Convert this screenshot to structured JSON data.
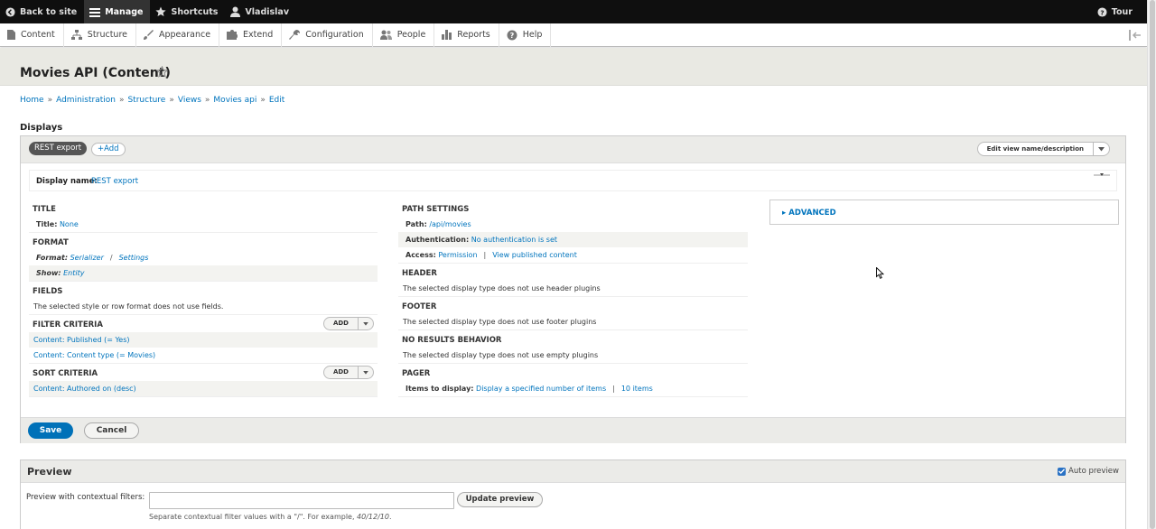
{
  "toolbar": {
    "back": "Back to site",
    "manage": "Manage",
    "shortcuts": "Shortcuts",
    "user": "Vladislav",
    "tour": "Tour"
  },
  "tray": [
    {
      "label": "Content",
      "icon": "file-icon"
    },
    {
      "label": "Structure",
      "icon": "structure-icon"
    },
    {
      "label": "Appearance",
      "icon": "brush-icon"
    },
    {
      "label": "Extend",
      "icon": "puzzle-icon"
    },
    {
      "label": "Configuration",
      "icon": "wrench-icon"
    },
    {
      "label": "People",
      "icon": "people-icon"
    },
    {
      "label": "Reports",
      "icon": "bar-chart-icon"
    },
    {
      "label": "Help",
      "icon": "help-icon"
    }
  ],
  "page": {
    "title": "Movies API (Content)"
  },
  "breadcrumb": [
    "Home",
    "Administration",
    "Structure",
    "Views",
    "Movies api",
    "Edit"
  ],
  "breadcrumb_sep": "»",
  "displays": {
    "heading": "Displays",
    "active_tab": "REST export",
    "add_tab": "+Add",
    "edit_name": "Edit view name/description"
  },
  "display_name": {
    "label": "Display name:",
    "value": "REST export"
  },
  "col1": {
    "title": {
      "heading": "TITLE",
      "label": "Title:",
      "value": "None"
    },
    "format": {
      "heading": "FORMAT",
      "format_label": "Format:",
      "format_value": "Serializer",
      "format_sep": "/",
      "settings": "Settings",
      "show_label": "Show:",
      "show_value": "Entity"
    },
    "fields": {
      "heading": "FIELDS",
      "text": "The selected style or row format does not use fields."
    },
    "filter": {
      "heading": "FILTER CRITERIA",
      "add": "Add",
      "items": [
        "Content: Published (= Yes)",
        "Content: Content type (= Movies)"
      ]
    },
    "sort": {
      "heading": "SORT CRITERIA",
      "add": "Add",
      "items": [
        "Content: Authored on (desc)"
      ]
    }
  },
  "col2": {
    "path": {
      "heading": "PATH SETTINGS",
      "path_label": "Path:",
      "path_value": "/api/movies",
      "auth_label": "Authentication:",
      "auth_value": "No authentication is set",
      "access_label": "Access:",
      "access_value": "Permission",
      "access_sep": "|",
      "access_extra": "View published content"
    },
    "header": {
      "heading": "HEADER",
      "text": "The selected display type does not use header plugins"
    },
    "footer": {
      "heading": "FOOTER",
      "text": "The selected display type does not use footer plugins"
    },
    "noresults": {
      "heading": "NO RESULTS BEHAVIOR",
      "text": "The selected display type does not use empty plugins"
    },
    "pager": {
      "heading": "PAGER",
      "label": "Items to display:",
      "value": "Display a specified number of items",
      "sep": "|",
      "count": "10 items"
    }
  },
  "col3": {
    "advanced": "ADVANCED"
  },
  "actions": {
    "save": "Save",
    "cancel": "Cancel"
  },
  "preview": {
    "title": "Preview",
    "auto": "Auto preview",
    "auto_checked": true,
    "filter_label": "Preview with contextual filters:",
    "filter_value": "",
    "update": "Update preview",
    "help_prefix": "Separate contextual filter values with a \"/\". For example,",
    "help_example": "40/12/10",
    "help_suffix": "."
  }
}
